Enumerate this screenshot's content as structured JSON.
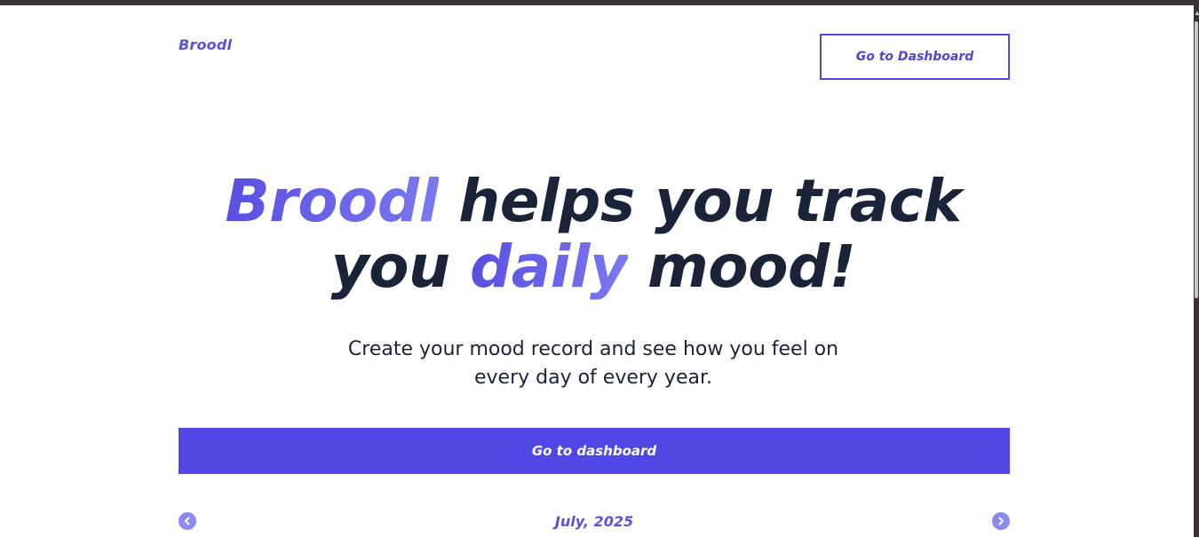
{
  "brand": {
    "name": "Broodl",
    "accent_color": "#5047e5"
  },
  "header": {
    "dashboard_button_label": "Go to Dashboard"
  },
  "hero": {
    "word1": "Broodl",
    "text1": " helps you track",
    "text2": "you ",
    "word2": "daily",
    "text3": " mood!"
  },
  "subtitle": {
    "line1": "Create your mood record and see how you feel on",
    "line2": "every day of every year."
  },
  "cta": {
    "label": "Go to dashboard"
  },
  "calendar": {
    "month_label": "July, 2025",
    "prev_icon": "chevron-left-icon",
    "next_icon": "chevron-right-icon"
  }
}
